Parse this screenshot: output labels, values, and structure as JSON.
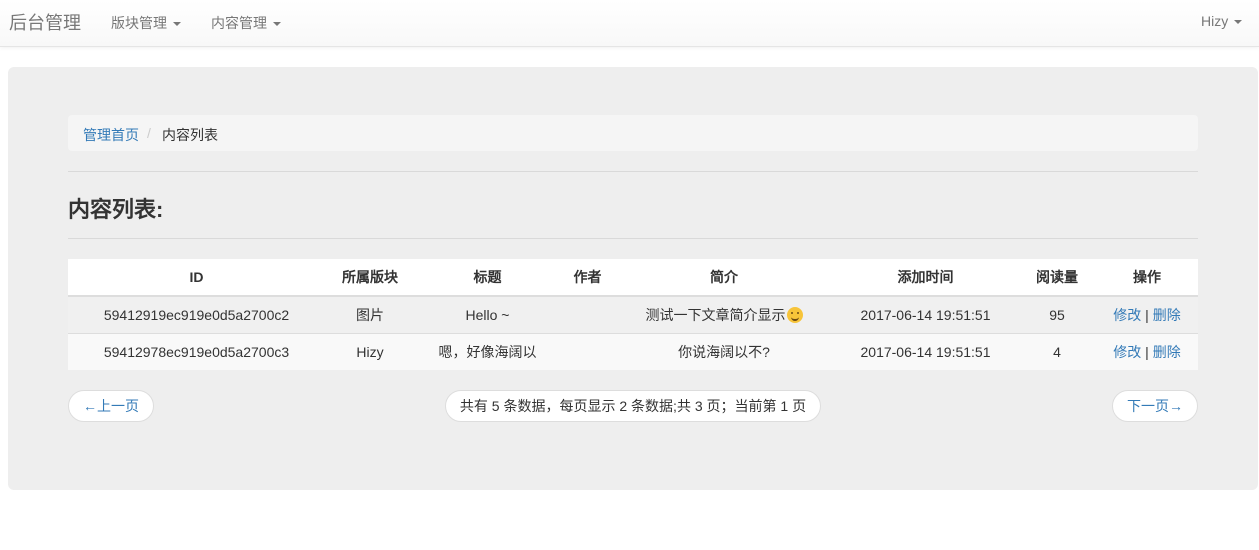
{
  "navbar": {
    "brand": "后台管理",
    "menus": [
      {
        "label": "版块管理"
      },
      {
        "label": "内容管理"
      }
    ],
    "user": "Hizy"
  },
  "breadcrumb": {
    "home": "管理首页",
    "separator": "/",
    "current": "内容列表"
  },
  "page": {
    "title": "内容列表:"
  },
  "table": {
    "headers": [
      "ID",
      "所属版块",
      "标题",
      "作者",
      "简介",
      "添加时间",
      "阅读量",
      "操作"
    ],
    "rows": [
      {
        "id": "59412919ec919e0d5a2700c2",
        "category": "图片",
        "title": "Hello ~",
        "author": "",
        "summary": "测试一下文章简介显示",
        "summary_emoji": "grinning-face-emoji",
        "time": "2017-06-14 19:51:51",
        "views": "95",
        "edit": "修改",
        "sep": "|",
        "delete": "删除"
      },
      {
        "id": "59412978ec919e0d5a2700c3",
        "category": "Hizy",
        "title": "嗯，好像海阔以",
        "author": "",
        "summary": "你说海阔以不?",
        "time": "2017-06-14 19:51:51",
        "views": "4",
        "edit": "修改",
        "sep": "|",
        "delete": "删除"
      }
    ]
  },
  "pager": {
    "prev": "←上一页",
    "info": "共有 5 条数据，每页显示 2 条数据;共 3 页；当前第 1 页",
    "next": "下一页→"
  },
  "colors": {
    "link": "#337ab7",
    "jumbotron_bg": "#eeeeee",
    "navbar_text": "#777777"
  }
}
